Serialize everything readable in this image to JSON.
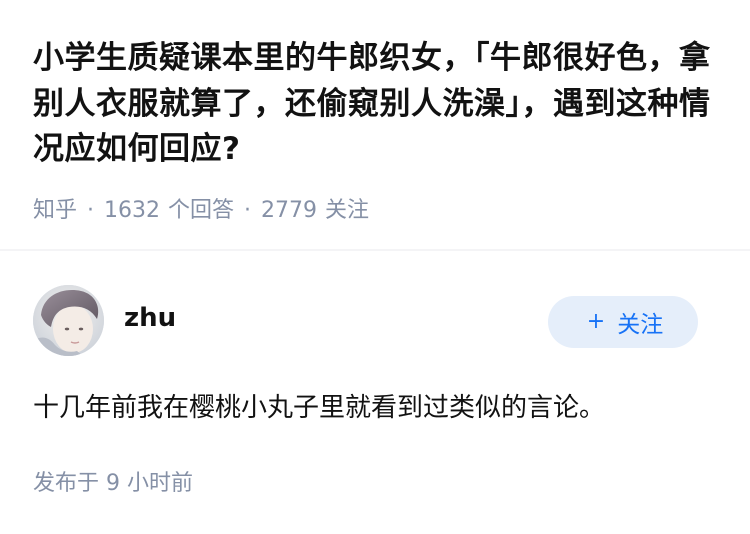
{
  "question": {
    "title": "小学生质疑课本里的牛郎织女，「牛郎很好色，拿别人衣服就算了，还偷窥别人洗澡」，遇到这种情况应如何回应?",
    "source": "知乎",
    "separator": "·",
    "answer_count": "1632",
    "answer_label": "个回答",
    "follower_count": "2779",
    "follower_label": "关注"
  },
  "answer": {
    "author": {
      "name": "zhu",
      "avatar_icon": "avatar-photo"
    },
    "follow_button": {
      "label": "关注",
      "icon": "plus-icon",
      "icon_glyph": "+"
    },
    "content": "十几年前我在樱桃小丸子里就看到过类似的言论。",
    "time_prefix": "发布于",
    "time_value": "9 小时前"
  },
  "colors": {
    "text_primary": "#121212",
    "text_secondary": "#8590a6",
    "accent": "#1772f6",
    "follow_bg": "#e5eefa"
  }
}
